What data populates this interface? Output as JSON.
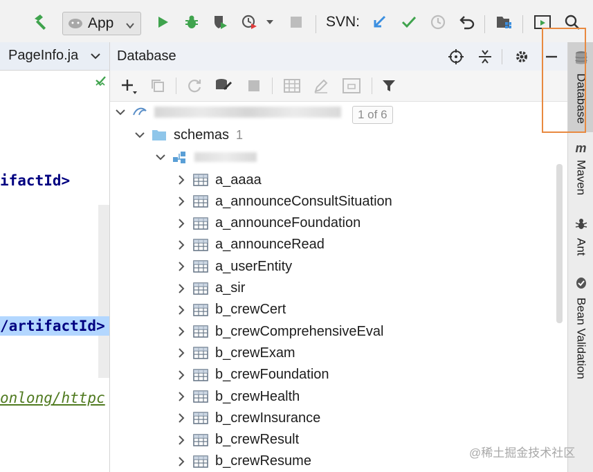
{
  "toolbar": {
    "run_config": "App",
    "svn_label": "SVN:"
  },
  "editor": {
    "tab_title": "PageInfo.ja",
    "code_lines": [
      "ifactId>",
      "/artifactId>",
      "onlong/httpc"
    ]
  },
  "database": {
    "title": "Database",
    "datasource_label": "1 of 6",
    "schemas_label": "schemas",
    "schemas_count": "1",
    "tables": [
      "a_aaaa",
      "a_announceConsultSituation",
      "a_announceFoundation",
      "a_announceRead",
      "a_userEntity",
      "a_sir",
      "b_crewCert",
      "b_crewComprehensiveEval",
      "b_crewExam",
      "b_crewFoundation",
      "b_crewHealth",
      "b_crewInsurance",
      "b_crewResult",
      "b_crewResume"
    ]
  },
  "right_strip": {
    "tabs": [
      "Database",
      "Maven",
      "Ant",
      "Bean Validation"
    ]
  },
  "watermark": "@稀土掘金技术社区",
  "colors": {
    "highlight": "#e8893f",
    "run_green": "#3fa34d",
    "svn_blue": "#3b8fe0",
    "selection": "#b3d7ff"
  }
}
